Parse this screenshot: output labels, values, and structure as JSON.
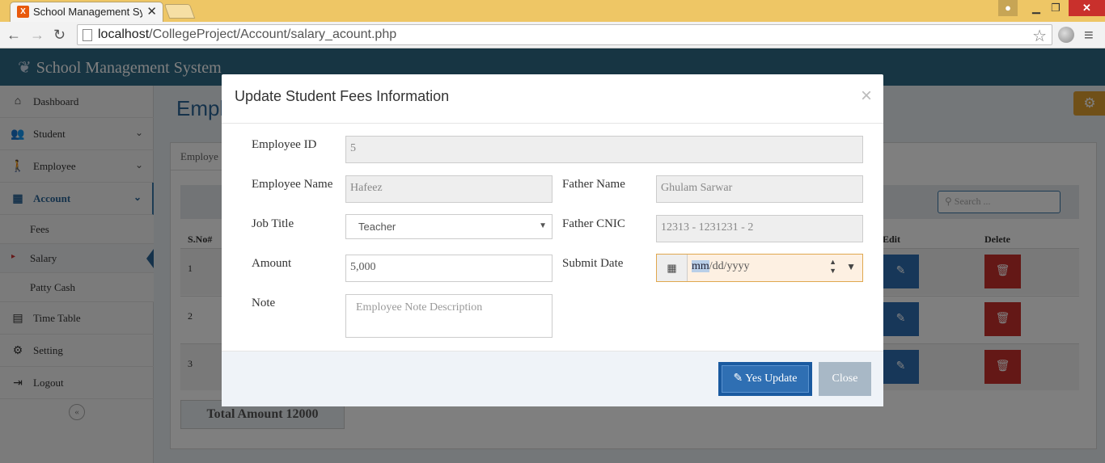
{
  "browser": {
    "tab_title": "School Management Syste",
    "url_host": "localhost",
    "url_path": "/CollegeProject/Account/salary_acount.php"
  },
  "app": {
    "brand": "School Management System",
    "sidebar": {
      "items": [
        {
          "label": "Dashboard"
        },
        {
          "label": "Student"
        },
        {
          "label": "Employee"
        },
        {
          "label": "Account"
        },
        {
          "label": "Time Table"
        },
        {
          "label": "Setting"
        },
        {
          "label": "Logout"
        }
      ],
      "sub_items": [
        {
          "label": "Fees"
        },
        {
          "label": "Salary"
        },
        {
          "label": "Patty Cash"
        }
      ]
    },
    "page_title": "Empl",
    "panel_tab": "Employe",
    "search_placeholder": "Search ...",
    "columns": {
      "sno": "S.No#",
      "edit": "Edit",
      "delete": "Delete"
    },
    "rows": [
      "1",
      "2",
      "3"
    ],
    "total": "Total Amount 12000"
  },
  "modal": {
    "title": "Update Student Fees Information",
    "close_glyph": "×",
    "fields": {
      "employee_id": {
        "label": "Employee ID",
        "value": "5"
      },
      "employee_name": {
        "label": "Employee Name",
        "value": "Hafeez"
      },
      "father_name": {
        "label": "Father Name",
        "value": "Ghulam Sarwar"
      },
      "job_title": {
        "label": "Job Title",
        "value": "Teacher"
      },
      "father_cnic": {
        "label": "Father CNIC",
        "value": "12313 - 1231231 - 2"
      },
      "amount": {
        "label": "Amount",
        "value": "5,000"
      },
      "submit_date": {
        "label": "Submit Date",
        "value_mm": "mm",
        "value_rest": "/dd/yyyy"
      },
      "note": {
        "label": "Note",
        "placeholder": "Employee Note Description"
      }
    },
    "buttons": {
      "update": "Yes Update",
      "close": "Close"
    }
  }
}
